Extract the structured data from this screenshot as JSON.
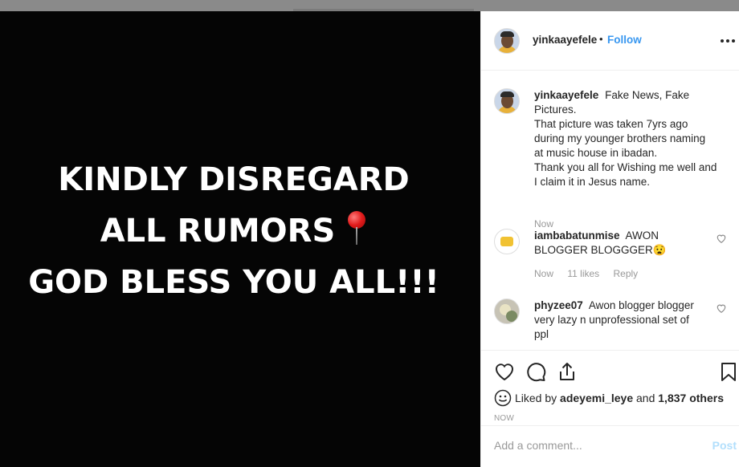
{
  "post_image": {
    "lines": [
      "KINDLY DISREGARD",
      "ALL RUMORS",
      "GOD BLESS YOU ALL!!!"
    ],
    "pin_icon": "round-pushpin-icon"
  },
  "header": {
    "username": "yinkaayefele",
    "separator": "•",
    "follow_label": "Follow",
    "more_icon": "more-options-icon"
  },
  "caption": {
    "username": "yinkaayefele",
    "lines": [
      "Fake News, Fake",
      "Pictures.",
      "That picture was taken 7yrs ago",
      "during my younger brothers naming",
      "at music house in ibadan.",
      "Thank you all for Wishing me well and",
      "I claim it in Jesus name."
    ],
    "time": "Now"
  },
  "comments": [
    {
      "username": "iambabatunmise",
      "text_line1": "AWON",
      "text_line2": "BLOGGER BLOGGGER😧",
      "time": "Now",
      "likes": "11 likes",
      "reply": "Reply"
    },
    {
      "username": "phyzee07",
      "text_line1": "Awon blogger blogger",
      "text_line2": "very lazy n unprofessional set of",
      "text_line3": "ppl"
    }
  ],
  "actions": {
    "like_icon": "heart-icon",
    "comment_icon": "comment-icon",
    "share_icon": "share-icon",
    "save_icon": "bookmark-icon"
  },
  "likes": {
    "prefix": "Liked by",
    "user": "adeyemi_leye",
    "conj": "and",
    "count": "1,837 others"
  },
  "timestamp": "NOW",
  "add_comment": {
    "placeholder": "Add a comment...",
    "post_label": "Post"
  }
}
